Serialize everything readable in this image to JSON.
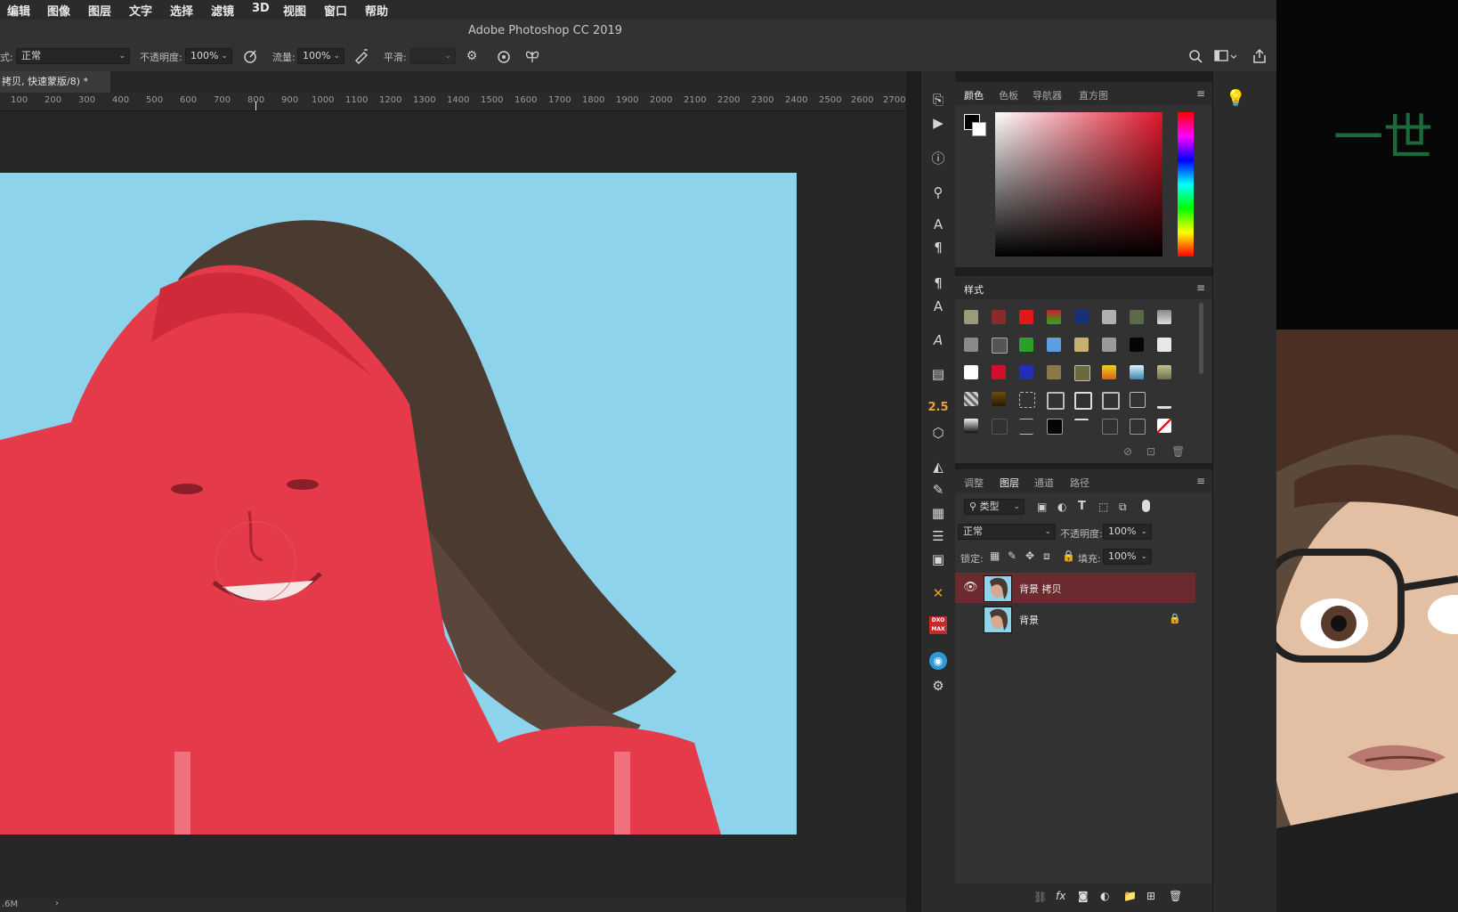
{
  "menu": [
    "编辑",
    "图像",
    "图层",
    "文字",
    "选择",
    "滤镜",
    "3D",
    "视图",
    "窗口",
    "帮助"
  ],
  "app_title": "Adobe Photoshop CC 2019",
  "options": {
    "mode_label": "式:",
    "mode_value": "正常",
    "opacity_label": "不透明度:",
    "opacity_value": "100%",
    "flow_label": "流量:",
    "flow_value": "100%",
    "smooth_label": "平滑:",
    "smooth_value": ""
  },
  "document_tab": "拷贝, 快速蒙版/8) *",
  "ruler_labels": [
    "100",
    "200",
    "300",
    "400",
    "500",
    "600",
    "700",
    "800",
    "900",
    "1000",
    "1100",
    "1200",
    "1300",
    "1400",
    "1500",
    "1600",
    "1700",
    "1800",
    "1900",
    "2000",
    "2100",
    "2200",
    "2300",
    "2400",
    "2500",
    "2600",
    "2700"
  ],
  "status": {
    "size": ".6M",
    "arrow": "›"
  },
  "color_panel": {
    "tabs": [
      "颜色",
      "色板",
      "导航器",
      "直方图"
    ],
    "accent": "#e0152a"
  },
  "styles_panel": {
    "title": "样式"
  },
  "layers_panel": {
    "tabs": [
      "调整",
      "图层",
      "通道",
      "路径"
    ],
    "filter_label": "类型",
    "blend_mode": "正常",
    "opacity_label": "不透明度:",
    "opacity_value": "100%",
    "lock_label": "锁定:",
    "fill_label": "填充:",
    "fill_value": "100%",
    "layers": [
      {
        "name": "背景 拷贝",
        "selected": true,
        "visible": true,
        "locked": false
      },
      {
        "name": "背景",
        "selected": false,
        "visible": false,
        "locked": true
      }
    ],
    "selected_color": "#6b2a2e"
  },
  "toolbar": {
    "value_label": "2.5",
    "dxo_label": "DXO MAX"
  },
  "video": {
    "banner_text": "一世"
  },
  "colors": {
    "quick_mask": "#e53a4a",
    "sky": "#8ed3ec"
  }
}
